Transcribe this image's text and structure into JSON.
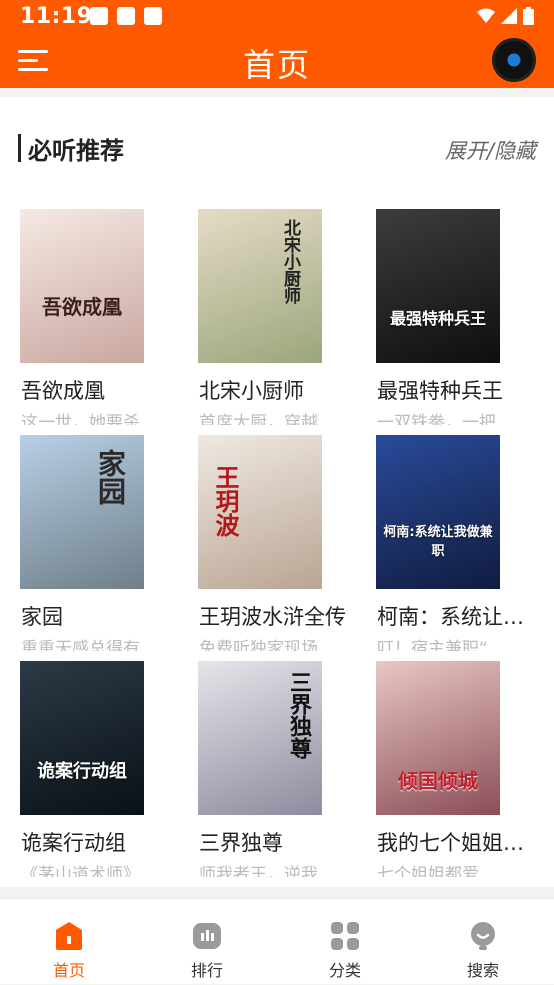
{
  "status": {
    "time": "11:19"
  },
  "header": {
    "title": "首页"
  },
  "section": {
    "title": "必听推荐",
    "toggle": "展开/隐藏"
  },
  "books": [
    {
      "title": "吾欲成凰",
      "desc": "这一世，她要杀",
      "cover_text": "吾欲成凰",
      "cover_colors": [
        "#f5e9e3",
        "#c9a7a0"
      ]
    },
    {
      "title": "北宋小厨师",
      "desc": "首席大厨，穿越",
      "cover_text": "北宋小厨师",
      "cover_colors": [
        "#e6dbc6",
        "#9aa67c"
      ]
    },
    {
      "title": "最强特种兵王",
      "desc": "一双铁拳，一把",
      "cover_text": "最强特种兵王",
      "cover_colors": [
        "#3d3d3d",
        "#0e0e0e"
      ]
    },
    {
      "title": "家园",
      "desc": "重重天感总得有",
      "cover_text": "家园",
      "cover_colors": [
        "#b9cfe6",
        "#6e7f88"
      ]
    },
    {
      "title": "王玥波水浒全传",
      "desc": "免费听独家现场",
      "cover_text": "王玥波",
      "cover_colors": [
        "#efe9e2",
        "#b9a593"
      ]
    },
    {
      "title": "柯南：系统让我做兼职",
      "desc": "叮！宿主兼职“",
      "cover_text": "柯南:系统让我做兼职",
      "cover_colors": [
        "#2a4b9a",
        "#101c3f"
      ]
    },
    {
      "title": "诡案行动组",
      "desc": "《茅山道术师》",
      "cover_text": "诡案行动组",
      "cover_colors": [
        "#2c3a47",
        "#0a1016"
      ]
    },
    {
      "title": "三界独尊",
      "desc": "师我者王，逆我",
      "cover_text": "三界独尊",
      "cover_colors": [
        "#e7e4ea",
        "#8f8a9e"
      ]
    },
    {
      "title": "我的七个姐姐倾国倾城",
      "desc": "七个姐姐都爱",
      "cover_text": "倾国倾城",
      "cover_colors": [
        "#e9c7c4",
        "#8a4e58"
      ]
    }
  ],
  "bottom_nav": [
    {
      "label": "首页",
      "active": true,
      "icon": "home-icon"
    },
    {
      "label": "排行",
      "active": false,
      "icon": "ranking-icon"
    },
    {
      "label": "分类",
      "active": false,
      "icon": "category-icon"
    },
    {
      "label": "搜索",
      "active": false,
      "icon": "search-icon"
    }
  ],
  "colors": {
    "brand": "#ff5a00",
    "nav_inactive": "#9a9a9a"
  }
}
